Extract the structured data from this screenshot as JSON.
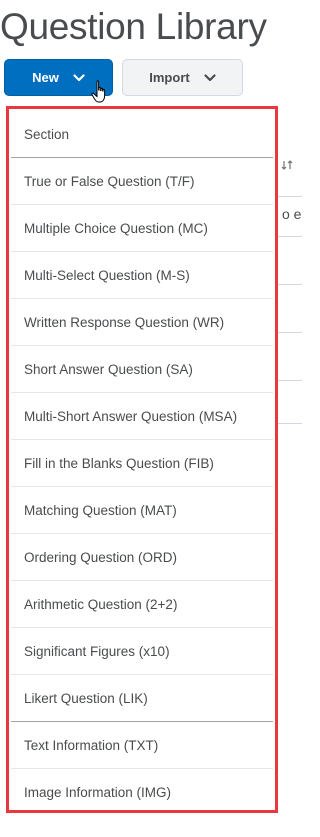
{
  "page": {
    "title": "Question Library"
  },
  "toolbar": {
    "new_label": "New",
    "import_label": "Import"
  },
  "background": {
    "partial_text": "o e"
  },
  "menu": {
    "items": [
      {
        "label": "Section"
      },
      {
        "label": "True or False Question (T/F)"
      },
      {
        "label": "Multiple Choice Question (MC)"
      },
      {
        "label": "Multi-Select Question (M-S)"
      },
      {
        "label": "Written Response Question (WR)"
      },
      {
        "label": "Short Answer Question (SA)"
      },
      {
        "label": "Multi-Short Answer Question (MSA)"
      },
      {
        "label": "Fill in the Blanks Question (FIB)"
      },
      {
        "label": "Matching Question (MAT)"
      },
      {
        "label": "Ordering Question (ORD)"
      },
      {
        "label": "Arithmetic Question (2+2)"
      },
      {
        "label": "Significant Figures (x10)"
      },
      {
        "label": "Likert Question (LIK)"
      },
      {
        "label": "Text Information (TXT)"
      },
      {
        "label": "Image Information (IMG)"
      }
    ]
  },
  "colors": {
    "primary_button": "#006fbf",
    "highlight_border": "#e8373f",
    "text": "#494c4e"
  }
}
